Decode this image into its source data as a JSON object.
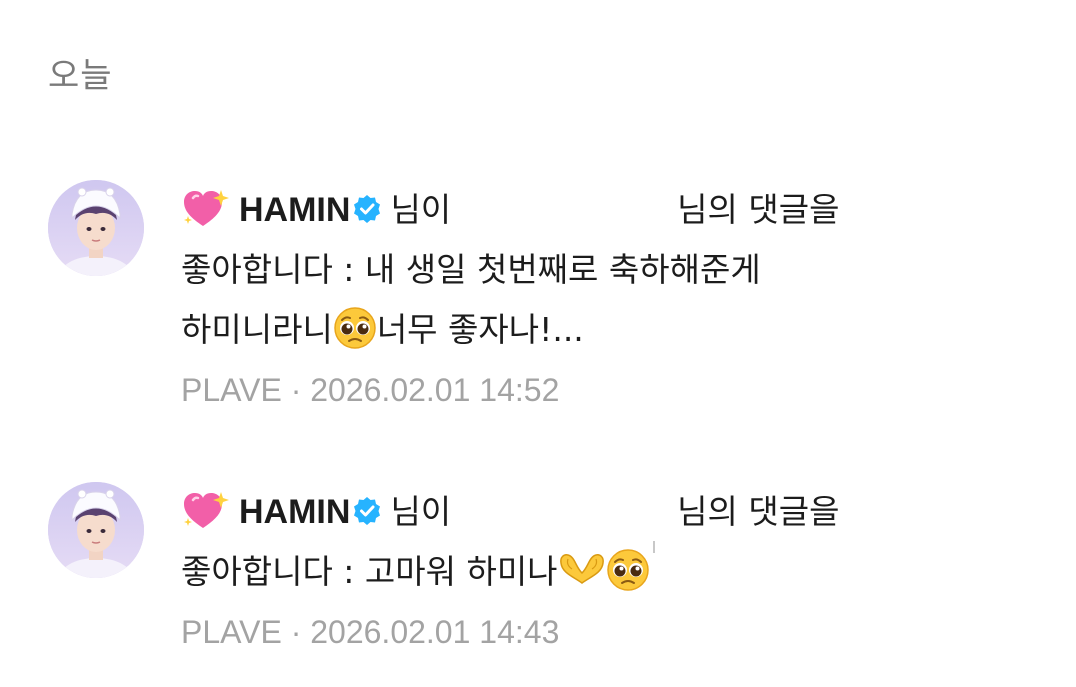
{
  "section_header": "오늘",
  "notifications": [
    {
      "user_name": "HAMIN",
      "suffix_1": "님이",
      "suffix_2": "님의 댓글을",
      "line_2": "좋아합니다 : 내 생일 첫번째로 축하해준게",
      "line_3_before": "하미니라니",
      "line_3_after": "너무 좋자나!...",
      "source": "PLAVE",
      "separator": "·",
      "timestamp": "2026.02.01 14:52"
    },
    {
      "user_name": "HAMIN",
      "suffix_1": "님이",
      "suffix_2": "님의 댓글을",
      "line_2": "좋아합니다 : 고마워 하미나",
      "source": "PLAVE",
      "separator": "·",
      "timestamp": "2026.02.01 14:43"
    }
  ],
  "icons": {
    "heart": "sparkling-heart-icon",
    "verified": "verified-badge-icon",
    "pleading_face": "pleading-face-emoji",
    "heart_hands": "heart-hands-emoji"
  },
  "colors": {
    "heart_pink": "#f25fa8",
    "verified_blue": "#26b3ff",
    "meta_gray": "#a3a3a3",
    "header_gray": "#7a7a7a"
  }
}
